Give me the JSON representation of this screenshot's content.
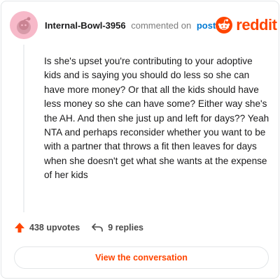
{
  "header": {
    "username": "Internal-Bowl-3956",
    "commented_text": "commented on",
    "post_link": "post",
    "brand": "reddit",
    "avatar_icon": "snoo-avatar-icon",
    "brand_icon": "reddit-logo-icon"
  },
  "comment": {
    "body": "Is she's upset you're contributing to your adoptive kids and is saying you should do less so she can have more money? Or that all the kids should have less money so she can have some? Either way she's the AH. And then she just up and left for days?? Yeah NTA and perhaps reconsider whether you want to be with a partner that throws a fit then leaves for days when she doesn't get what she wants at the expense of her kids"
  },
  "actions": {
    "upvotes": "438 upvotes",
    "replies": "9 replies",
    "upvote_icon": "upvote-arrow-icon",
    "reply_icon": "reply-arrow-icon"
  },
  "cta": {
    "label": "View the conversation"
  },
  "colors": {
    "accent": "#ff4500",
    "link": "#0079d3",
    "avatar_bg": "#f7b9c9"
  }
}
